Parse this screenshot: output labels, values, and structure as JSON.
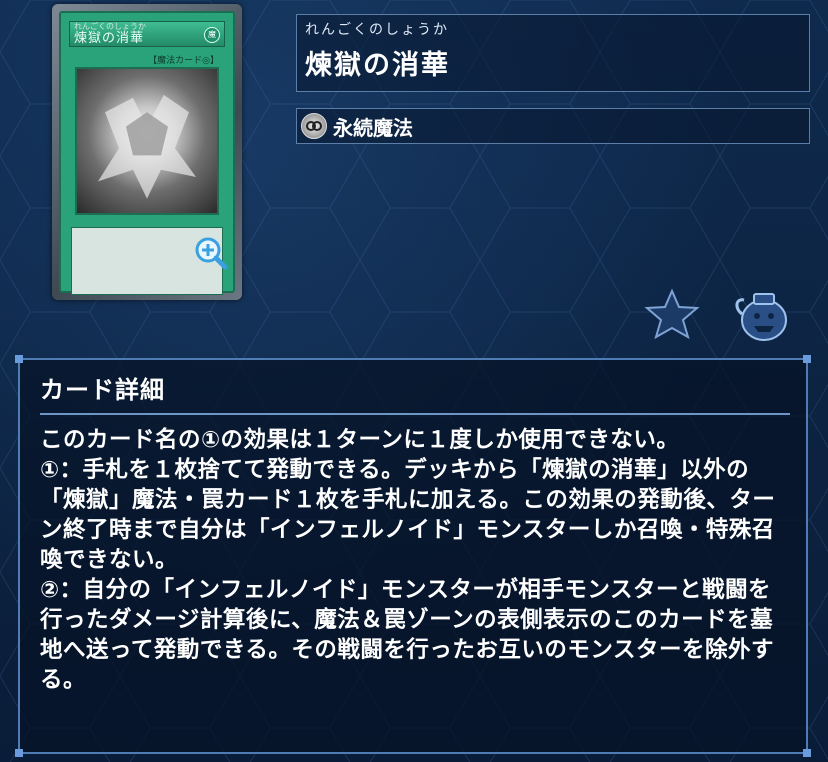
{
  "card": {
    "ruby_small": "れんごくのしょうか",
    "name": "煉獄の消華",
    "attribute_symbol": "魔",
    "type_line": "【魔法カード◎】"
  },
  "name_panel": {
    "ruby": "れんごくのしょうか",
    "name": "煉獄の消華"
  },
  "type_panel": {
    "icon": "continuous-spell-icon",
    "label": "永続魔法"
  },
  "detail": {
    "header": "カード詳細",
    "text": "このカード名の①の効果は１ターンに１度しか使用できない。\n①：手札を１枚捨てて発動できる。デッキから「煉獄の消華」以外の「煉獄」魔法・罠カード１枚を手札に加える。この効果の発動後、ターン終了時まで自分は「インフェルノイド」モンスターしか召喚・特殊召喚できない。\n②：自分の「インフェルノイド」モンスターが相手モンスターと戦闘を行ったダメージ計算後に、魔法＆罠ゾーンの表側表示のこのカードを墓地へ送って発動できる。その戦闘を行ったお互いのモンスターを除外する。"
  },
  "colors": {
    "background": "#0d2342",
    "panel_border": "#4f7cb4",
    "card_green": "#2aa37b"
  }
}
